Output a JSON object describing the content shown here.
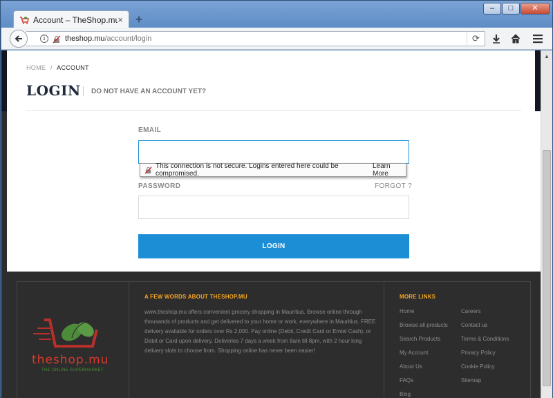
{
  "browser": {
    "tab_title": "Account – TheShop.mu",
    "tab_close": "×",
    "new_tab": "+",
    "url_host": "theshop.mu",
    "url_path": "/account/login",
    "win_min": "–",
    "win_max": "□",
    "win_close": "✕"
  },
  "page": {
    "breadcrumb_home": "HOME",
    "breadcrumb_sep": "/",
    "breadcrumb_current": "ACCOUNT",
    "title": "LOGIN",
    "no_account": "DO NOT HAVE AN ACCOUNT YET?",
    "email_label": "EMAIL",
    "email_value": "",
    "password_label": "PASSWORD",
    "password_value": "",
    "forgot": "FORGOT ?",
    "login_button": "LOGIN",
    "insecure_warning": "This connection is not secure. Logins entered here could be compromised.",
    "learn_more": "Learn More"
  },
  "footer": {
    "logo_text": "theshop.mu",
    "logo_sub": "THE ONLINE SUPERMARKET",
    "about_heading": "A FEW WORDS ABOUT THESHOP.MU",
    "about_text": "www.theshop.mu offers convenient grocery shopping in Mauritius. Browse online through thousands of products and get delivered to your home or work, everywhere in Mauritius. FREE delivery available for orders over Rs 2,000. Pay online (Debit, Credit Card or Emtel Cash), or Debit or Card upon delivery. Deliveries 7 days a week from 8am till 8pm, with 2 hour long delivery slots to choose from. Shopping online has never been easier!",
    "links_heading": "MORE LINKS",
    "links_col1": [
      "Home",
      "Browse all products",
      "Search Products",
      "My Account",
      "About Us",
      "FAQs",
      "Blog"
    ],
    "links_col2": [
      "Careers",
      "Contact us",
      "Terms & Conditions",
      "Privacy Policy",
      "Cookie Policy",
      "Sitemap"
    ]
  },
  "colors": {
    "accent": "#1b8ed6",
    "footer_heading": "#f5a623",
    "footer_bg": "#2d2d2d",
    "logo_red": "#d83a2c",
    "logo_green": "#4c8b3a"
  }
}
